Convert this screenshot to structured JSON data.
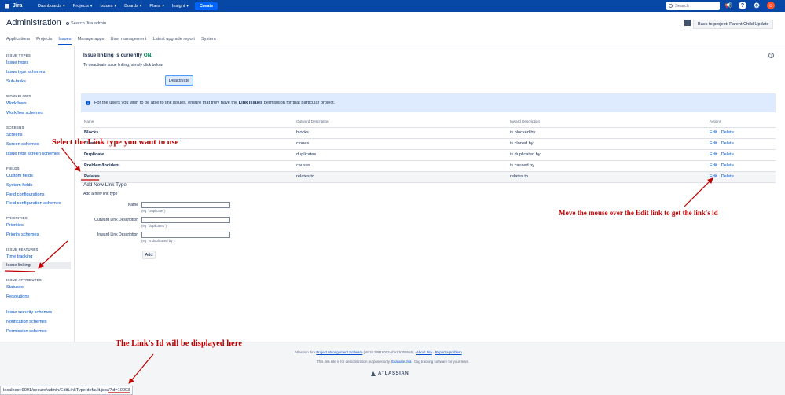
{
  "topnav": {
    "logo": "Jira",
    "items": [
      {
        "label": "Dashboards"
      },
      {
        "label": "Projects"
      },
      {
        "label": "Issues"
      },
      {
        "label": "Boards"
      },
      {
        "label": "Plans"
      },
      {
        "label": "Insight"
      }
    ],
    "create_label": "Create",
    "search_placeholder": "Search",
    "icons": [
      "notification-icon",
      "help-icon",
      "settings-icon",
      "avatar"
    ]
  },
  "header": {
    "title": "Administration",
    "search_label": "Search Jira admin",
    "back_label": "Back to project: Parent Child Update",
    "tabs": [
      {
        "label": "Applications"
      },
      {
        "label": "Projects"
      },
      {
        "label": "Issues",
        "active": true
      },
      {
        "label": "Manage apps"
      },
      {
        "label": "User management"
      },
      {
        "label": "Latest upgrade report"
      },
      {
        "label": "System"
      }
    ]
  },
  "sidebar": {
    "issue_types": {
      "title": "ISSUE TYPES",
      "items": [
        "Issue types",
        "Issue type schemes",
        "Sub-tasks"
      ]
    },
    "workflows": {
      "title": "WORKFLOWS",
      "items": [
        "Workflows",
        "Workflow schemes"
      ]
    },
    "screens": {
      "title": "SCREENS",
      "items": [
        "Screens",
        "Screen schemes",
        "Issue type screen schemes"
      ]
    },
    "fields": {
      "title": "FIELDS",
      "items": [
        "Custom fields",
        "System fields",
        "Field configurations",
        "Field configuration schemes"
      ]
    },
    "priorities": {
      "title": "PRIORITIES",
      "items": [
        "Priorities",
        "Priority schemes"
      ]
    },
    "issue_features": {
      "title": "ISSUE FEATURES",
      "items": [
        "Time tracking",
        "Issue linking"
      ]
    },
    "issue_attributes": {
      "title": "ISSUE ATTRIBUTES",
      "items": [
        "Statuses",
        "Resolutions"
      ]
    },
    "other": {
      "items": [
        "Issue security schemes",
        "Notification schemes",
        "Permission schemes"
      ]
    }
  },
  "main": {
    "heading_prefix": "Issue linking is currently ",
    "heading_status": "ON.",
    "subtext": "To deactivate issue linking, simply click below.",
    "deactivate_label": "Deactivate",
    "info_prefix": "For the users you wish to be able to link issues, ensure that they have the ",
    "info_bold": "Link Issues",
    "info_suffix": " permission for that particular project.",
    "table": {
      "headers": {
        "name": "Name",
        "outward": "Outward Description",
        "inward": "Inward Description",
        "actions": "Actions"
      },
      "rows": [
        {
          "name": "Blocks",
          "outward": "blocks",
          "inward": "is blocked by",
          "edit": "Edit",
          "delete": "Delete"
        },
        {
          "name": "Cloners",
          "outward": "clones",
          "inward": "is cloned by",
          "edit": "Edit",
          "delete": "Delete"
        },
        {
          "name": "Duplicate",
          "outward": "duplicates",
          "inward": "is duplicated by",
          "edit": "Edit",
          "delete": "Delete"
        },
        {
          "name": "Problem/Incident",
          "outward": "causes",
          "inward": "is caused by",
          "edit": "Edit",
          "delete": "Delete"
        },
        {
          "name": "Relates",
          "outward": "relates to",
          "inward": "relates to",
          "edit": "Edit",
          "delete": "Delete"
        }
      ]
    },
    "add_form": {
      "title": "Add New Link Type",
      "subtitle": "Add a new link type",
      "name_label": "Name",
      "name_hint": "(eg \"Duplicate\")",
      "outward_label": "Outward Link Description",
      "outward_hint": "(eg \"duplicates\")",
      "inward_label": "Inward Link Description",
      "inward_hint": "(eg \"is duplicated by\")",
      "add_label": "Add"
    }
  },
  "footer": {
    "line1_prefix": "Atlassian Jira ",
    "line1_link": "Project Management Software",
    "line1_version": " (v8.18.2#818002-sha1:53055e5)  ·  ",
    "about_link": "About Jira",
    "sep": "  ·  ",
    "report_link": "Report a problem",
    "line2_prefix": "This Jira site is for demonstration purposes only. ",
    "evaluate_link": "Evaluate Jira",
    "line2_suffix": " - bug tracking software for your team.",
    "atlassian": "ATLASSIAN"
  },
  "statusbar": {
    "url": "localhost:9091/secure/admin/EditLinkType!default.jspa?id=10003"
  },
  "annotations": {
    "select": "Select the Link type you want to use",
    "hover": "Move the mouse over the Edit link to get the link's id",
    "displayed": "The Link's Id will be displayed here",
    "color": "#C00000"
  }
}
